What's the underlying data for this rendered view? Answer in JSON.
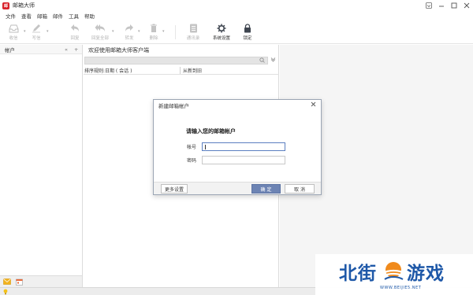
{
  "window": {
    "title": "邮箱大师",
    "logo_text": "邮"
  },
  "menu": [
    "文件",
    "查看",
    "邮箱",
    "邮件",
    "工具",
    "帮助"
  ],
  "toolbar": {
    "receive": "收信",
    "compose": "写信",
    "reply": "回复",
    "reply_all": "回复全部",
    "forward": "转发",
    "delete": "删除",
    "contacts": "通讯录",
    "settings": "系统设置",
    "lock": "锁定"
  },
  "left_pane": {
    "title": "帐户"
  },
  "main_pane": {
    "welcome": "欢迎使用邮箱大师客户端",
    "sort_label": "排序规则:日期 ( 会话 )",
    "sort_order": "从新到旧"
  },
  "dialog": {
    "title": "新建邮箱帐户",
    "heading": "请输入您的邮箱帐户",
    "account_label": "帐号",
    "account_value": "",
    "password_label": "密码",
    "password_value": "",
    "more_settings": "更多设置",
    "ok": "确 定",
    "cancel": "取 消"
  },
  "watermark": {
    "left": "北街",
    "right": "游戏",
    "url": "WWW.BEIJIE5.NET"
  },
  "colors": {
    "accent": "#6d84b4",
    "logo": "#d8222b",
    "watermark_blue": "#1e58a8",
    "watermark_orange": "#f08a1c"
  }
}
